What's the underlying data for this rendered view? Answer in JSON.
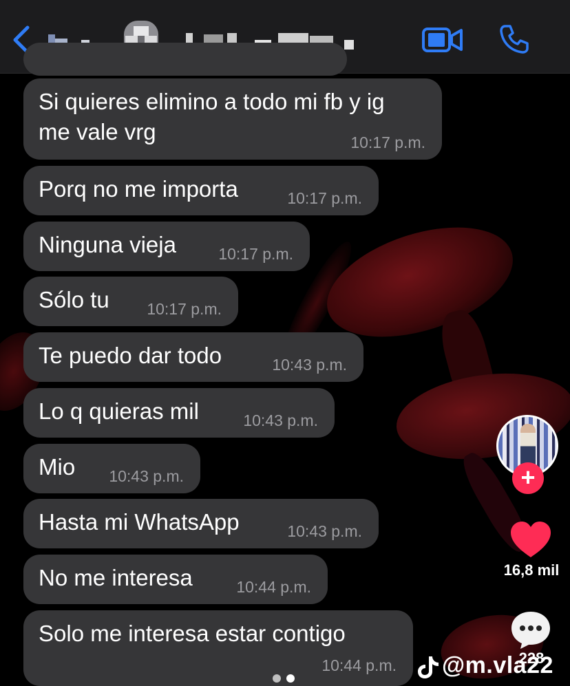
{
  "chat": {
    "messages": [
      {
        "text": "Si quieres elimino a todo mi fb y ig",
        "text2": "me vale vrg",
        "time": "10:17 p.m."
      },
      {
        "text": "Porq no me importa",
        "time": "10:17 p.m."
      },
      {
        "text": "Ninguna vieja",
        "time": "10:17 p.m."
      },
      {
        "text": "Sólo tu",
        "time": "10:17 p.m."
      },
      {
        "text": "Te puedo dar todo",
        "time": "10:43 p.m."
      },
      {
        "text": "Lo q quieras mil",
        "time": "10:43 p.m."
      },
      {
        "text": "Mio",
        "time": "10:43 p.m."
      },
      {
        "text": "Hasta mi WhatsApp",
        "time": "10:43 p.m."
      },
      {
        "text": "No me interesa",
        "time": "10:44 p.m."
      },
      {
        "text": "Solo me interesa estar contigo",
        "time": "10:44 p.m."
      }
    ]
  },
  "overlay": {
    "likes": "16,8 mil",
    "comments": "228",
    "username": "@m.vla22"
  },
  "colors": {
    "bubble": "#363638",
    "header": "#1c1c1e",
    "accent_blue": "#2f7cf6",
    "like_red": "#fe2c55"
  },
  "icons": [
    "back-chevron-icon",
    "video-call-icon",
    "phone-call-icon",
    "heart-icon",
    "comment-icon",
    "tiktok-logo-icon"
  ]
}
